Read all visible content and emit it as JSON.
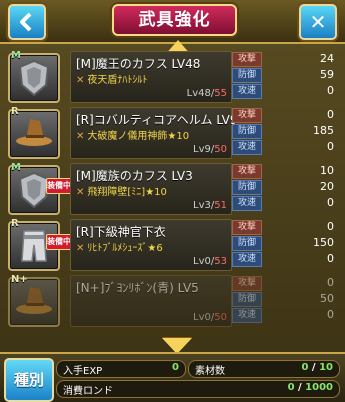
{
  "header": {
    "title": "武具強化",
    "back_icon": "back-arrow-icon",
    "close_label": "✕"
  },
  "items": [
    {
      "rarity": "M",
      "icon": "shield-icon",
      "equipped": false,
      "name": "[M]魔王のカフス LV48",
      "skill": "夜天盾ﾅﾊﾄｼﾙﾄ",
      "level_cur": "Lv48",
      "level_max": "55",
      "attack": "24",
      "defense": "59",
      "speed": "0"
    },
    {
      "rarity": "R",
      "icon": "hat-icon",
      "equipped": false,
      "name": "[R]コバルティコアヘルム LV9",
      "skill": "大破魔ノ儀用神飾",
      "skill_star": "★10",
      "level_cur": "Lv9",
      "level_max": "50",
      "attack": "0",
      "defense": "185",
      "speed": "0"
    },
    {
      "rarity": "M",
      "icon": "shield-icon",
      "equipped": true,
      "equipped_label": "装備中",
      "name": "[M]魔族のカフス LV3",
      "skill": "飛翔障壁[ﾐﾆ]",
      "skill_star": "★10",
      "level_cur": "Lv3",
      "level_max": "51",
      "attack": "10",
      "defense": "20",
      "speed": "0"
    },
    {
      "rarity": "R",
      "icon": "robe-icon",
      "equipped": true,
      "equipped_label": "装備中",
      "name": "[R]下級神官下衣",
      "skill": "ﾘﾋﾄﾌﾞﾙﾒｼｭｰｽﾞ",
      "skill_star": "★6",
      "level_cur": "Lv0",
      "level_max": "53",
      "attack": "0",
      "defense": "150",
      "speed": "0"
    },
    {
      "rarity": "N+",
      "icon": "hat-icon",
      "equipped": false,
      "name": "[N+]ﾌﾞﾖﾝﾘﾎﾞﾝ(青) LV5",
      "skill": "",
      "level_cur": "Lv0",
      "level_max": "50",
      "attack": "0",
      "defense": "50",
      "speed": "0"
    }
  ],
  "stat_labels": {
    "attack": "攻撃",
    "defense": "防御",
    "speed": "攻速"
  },
  "footer": {
    "kind_label": "種別",
    "exp_label": "入手EXP",
    "exp_value": "0",
    "material_label": "素材数",
    "material_value": "0",
    "material_max": "10",
    "cost_label": "消費ロンド",
    "cost_value": "0",
    "cost_max": "1000"
  },
  "colors": {
    "accent_blue": "#1a82c8",
    "title_red": "#b41a4a",
    "gold": "#caa64a"
  }
}
